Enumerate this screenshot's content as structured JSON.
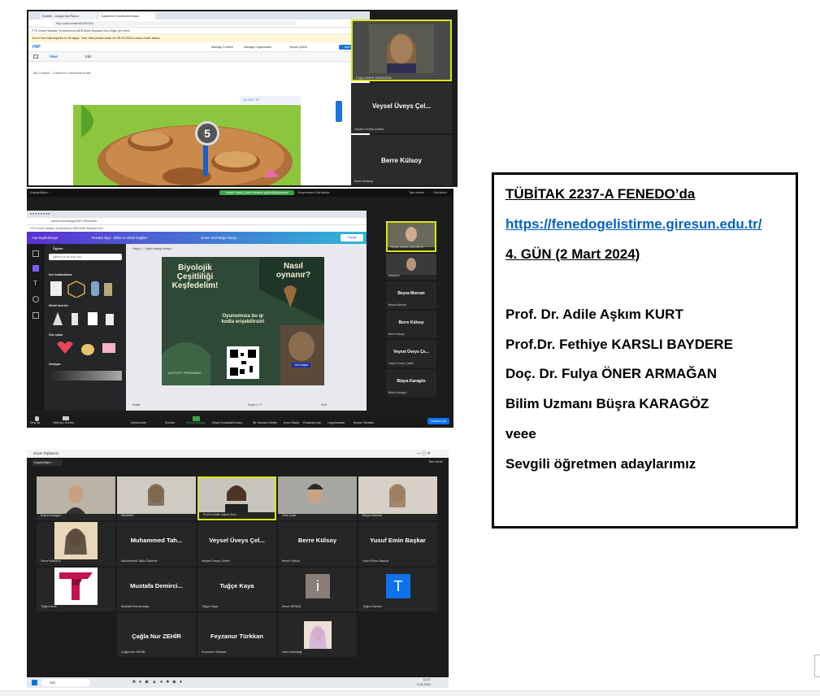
{
  "screenshot1": {
    "tabs": [
      "Kediler - Araştırma Rapor",
      "Canlıların Sınıflandırılması"
    ],
    "url": "h5p.com/content/1292161",
    "bookmarks": "PTS  Gmail  Haritalar  Sınıflandırma  MEB  Bekle  Blokada  Soru  Diğer yer imleri",
    "trial_notice": "Your Free trial expires in 30 days. Your trial period ends on 25.03.2024  Learn more about",
    "app_logo": "H5P",
    "header_buttons": [
      "Manage Content",
      "Manage Organization",
      "Veysel Çelebi"
    ],
    "add_button": "Add Content",
    "view_tab": "View",
    "edit_tab": "Edit",
    "breadcrumb": "My Content  ›  Canlıların Sınıflandırılması",
    "game_toolbar": "0 / 8     0 / 17",
    "game_number": "5",
    "participants": [
      {
        "name": "Fulya ÖNER ARMAĞAN",
        "sub": "Fulya ÖNER ARMAĞAN"
      },
      {
        "name": "Veysel Üveys Çel...",
        "sub": "Veysel Üveys Çelebi"
      },
      {
        "name": "Berre Külsoy",
        "sub": "Berre Külsoy"
      }
    ]
  },
  "screenshot2": {
    "recording": "Kaydediliyor...",
    "share_banner": "Veysel Üveys Çelebi ekranını görüntülüyorsunuz",
    "view_options": "Seçenekleri Görüntüle",
    "top_right": [
      "Tam ekran",
      "Görünüm"
    ],
    "canva_url": "canva.com/design/DAF-9Tekm/edit",
    "canva_bookmarks": "PTS  Gmail  Haritalar  Sınıflandırma  MEB  Bekle  Blokada  Soru",
    "canva_menu": [
      "Ana Sayfa",
      "Dosya"
    ],
    "canva_title": "Fenden Biyo.. Bilim ve Sihirli Dağılım",
    "canva_doc": "Green and Beige Recyc..",
    "canva_share": "Paylaş",
    "panel_title": "Öğeler",
    "panel_search": "öğeleri ya da araç ara",
    "panel_sections": [
      "Son kullanılanlar",
      "Sihirli öneriler",
      "Öne çıkan",
      "Gradyan"
    ],
    "slide_title": "Biyolojik Çeşitliliği Keşfedelim!",
    "slide_question": "Nasıl oynanır?",
    "slide_qr_text": "Oyunumuza bu qr kodla erişebilirsin!",
    "slide_footer": "ACTIVITY PROGRAM",
    "slide_tag": "Yeni başlık",
    "page_label": "Sayfa 1 - Sayfa başlığı ekleyin",
    "notes": "Notlar",
    "page_indicator": "Sayfa 1 / 2",
    "zoom": "%46",
    "right_tiles": [
      {
        "name": "",
        "sub": "Fethiye KARSLI BAYDERE"
      },
      {
        "name": "",
        "sub": "Misafirler"
      },
      {
        "name": "Beyza Mercan",
        "sub": "Beyza Mercan"
      },
      {
        "name": "Berre Külsoy",
        "sub": "Berre Külsoy"
      },
      {
        "name": "Veysel Üveys Çe...",
        "sub": "Veysel Üveys Çelebi"
      },
      {
        "name": "Büşra Karagöz",
        "sub": "Büşra Karagöz"
      }
    ],
    "toolbar": [
      "Sesi aç",
      "Videoyu Durdur",
      "Katılımcılar",
      "Sohbet",
      "Ekranı paylaş",
      "Kaydı Duraklat/Durdur",
      "Alt Yazıları Göster",
      "Ana Odalar",
      "Reaksiyonlar",
      "Uygulamalar",
      "Beyaz Tahtalar"
    ],
    "end_button": "Odadan Çık"
  },
  "screenshot3": {
    "window_title": "Zoom Toplantısı",
    "recording": "Kaydediliyor...",
    "top_right": "Tam ekran",
    "grid": [
      {
        "name": "",
        "sub": "Büşra Karagöz",
        "photo": true
      },
      {
        "name": "",
        "sub": "Misafirler",
        "photo": true
      },
      {
        "name": "",
        "sub": "Prof.Dr.Adile Aşkım Kurt",
        "photo": true
      },
      {
        "name": "",
        "sub": "Ufuk Çelik",
        "photo": true
      },
      {
        "name": "",
        "sub": "Beyza Mercan",
        "photo": true
      },
      {
        "name": "",
        "sub": "Sena Kabukcu",
        "photo": true
      },
      {
        "name": "Muhammed Tah...",
        "sub": "Muhammed Taha Özdemir"
      },
      {
        "name": "Veysel Üveys Çel...",
        "sub": "Veysel Üveys Çelebi"
      },
      {
        "name": "Berre Külsoy",
        "sub": "Berre Külsoy"
      },
      {
        "name": "Yusuf Emin Başkar",
        "sub": "Yusuf Emin Başkar"
      },
      {
        "name": "",
        "sub": "Tuğba Ünal",
        "logo": "T"
      },
      {
        "name": "Mustafa Demirci...",
        "sub": "Mustafa Demircioğlu"
      },
      {
        "name": "Tuğçe Kaya",
        "sub": "Tuğçe Kaya"
      },
      {
        "name": "",
        "sub": "İlknur ARSAN",
        "avatar": "i"
      },
      {
        "name": "",
        "sub": "Tuğba Özmen",
        "avatar": "T"
      },
      {
        "name": "Çağla Nur ZEHİR",
        "sub": "Çağla Nur ZEHİR"
      },
      {
        "name": "Feyzanur Türkkan",
        "sub": "Feyzanur Türkkan"
      },
      {
        "name": "",
        "sub": "Nazlı Albostağ",
        "photo": true
      }
    ],
    "taskbar_search": "Ara",
    "taskbar_time": "13:37",
    "taskbar_date": "2.03.2024"
  },
  "textbox": {
    "line1": "TÜBİTAK 2237-A FENEDO’da",
    "line2": "https://fenedogelistirme.giresun.edu.tr/",
    "line3": "4. GÜN (2 Mart 2024)",
    "line4": "Prof. Dr. Adile Aşkım KURT",
    "line5": "Prof.Dr. Fethiye KARSLI BAYDERE",
    "line6": "Doç. Dr. Fulya ÖNER ARMAĞAN",
    "line7": "Bilim Uzmanı Büşra KARAGÖZ",
    "line8": "veee",
    "line9": "Sevgili öğretmen adaylarımız"
  },
  "colors": {
    "link": "#0563c1",
    "zoom_bg": "#1c1c1c",
    "zoom_blue": "#0e72ed",
    "canva_purple": "#5b2fd2",
    "h5p_blue": "#1a73d9"
  }
}
